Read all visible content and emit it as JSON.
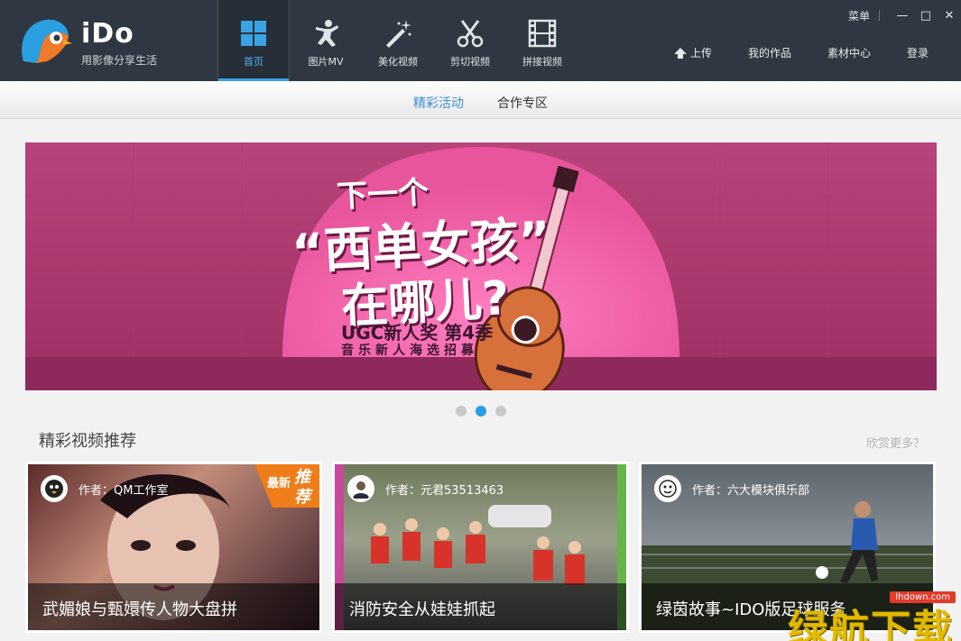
{
  "app": {
    "brand": "iDo",
    "slogan": "用影像分享生活"
  },
  "nav": [
    {
      "label": "首页",
      "icon": "home-grid-icon",
      "active": true
    },
    {
      "label": "图片MV",
      "icon": "dancer-icon"
    },
    {
      "label": "美化视频",
      "icon": "magic-wand-icon"
    },
    {
      "label": "剪切视频",
      "icon": "scissors-icon"
    },
    {
      "label": "拼接视频",
      "icon": "film-strip-icon"
    }
  ],
  "window": {
    "menu": "菜单",
    "minimize": "—",
    "maximize": "□",
    "close": "✕"
  },
  "links": {
    "upload": "上传",
    "my_works": "我的作品",
    "materials": "素材中心",
    "login": "登录"
  },
  "subnav": {
    "tab1": "精彩活动",
    "tab2": "合作专区"
  },
  "banner": {
    "line1": "下一个",
    "line2": "“西单女孩”",
    "line3": "在哪儿?",
    "sub1": "UGC新人奖 第4季",
    "sub2": "音乐新人海选招募",
    "dots": 3,
    "active_dot": 2
  },
  "section": {
    "title": "精彩视频推荐",
    "more": "欣赏更多？"
  },
  "cards": [
    {
      "author": "作者：QM工作室",
      "caption": "武媚娘与甄嬛传人物大盘拼",
      "badge1": "最新",
      "badge2": "推荐"
    },
    {
      "author": "作者：元君53513463",
      "caption": "消防安全从娃娃抓起"
    },
    {
      "author": "作者：六大模块俱乐部",
      "caption": "绿茵故事~IDO版足球服务"
    }
  ],
  "watermark": {
    "site": "lhdown.com",
    "text": "绿航下载"
  },
  "colors": {
    "header": "#2f3842",
    "accent": "#3aa3e3",
    "banner": "#b8447a"
  }
}
